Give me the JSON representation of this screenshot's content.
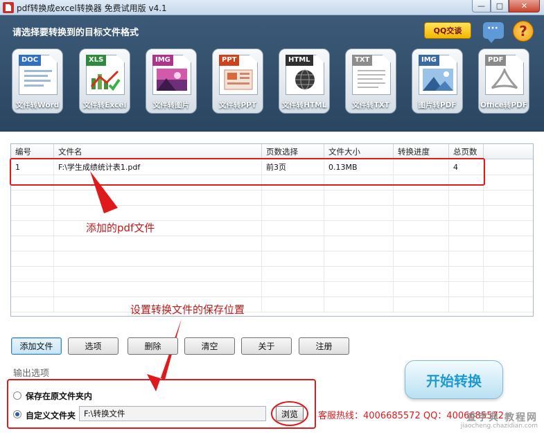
{
  "window": {
    "title": "pdf转换成excel转换器 免费试用版 v4.1",
    "minimize": "—",
    "maximize": "□",
    "close": "✕"
  },
  "toolbar": {
    "prompt": "请选择要转换到的目标文件格式",
    "qq_badge": "QQ交谈",
    "help": "?",
    "formats": [
      {
        "tag": "DOC",
        "label": "文件转Word",
        "color": "#2f6fc4"
      },
      {
        "tag": "XLS",
        "label": "文件转Excel",
        "color": "#2e8b3e"
      },
      {
        "tag": "IMG",
        "label": "文件转图片",
        "color": "#b0338a"
      },
      {
        "tag": "PPT",
        "label": "文件转PPT",
        "color": "#d0421b"
      },
      {
        "tag": "HTML",
        "label": "文件转HTML",
        "color": "#303030"
      },
      {
        "tag": "TXT",
        "label": "文件转TXT",
        "color": "#8d8d8d"
      },
      {
        "tag": "IMG",
        "label": "图片转PDF",
        "color": "#3a6aa6"
      },
      {
        "tag": "PDF",
        "label": "Office转PDF",
        "color": "#8a8a8a"
      }
    ]
  },
  "table": {
    "columns": [
      "编号",
      "文件名",
      "页数选择",
      "文件大小",
      "转换进度",
      "总页数"
    ],
    "rows": [
      [
        "1",
        "F:\\学生成绩统计表1.pdf",
        "前3页",
        "0.13MB",
        "",
        "4"
      ]
    ]
  },
  "annotations": {
    "added_file": "添加的pdf文件",
    "save_location": "设置转换文件的保存位置"
  },
  "buttons": {
    "add_file": "添加文件",
    "options": "选项",
    "delete": "删除",
    "clear": "清空",
    "about": "关于",
    "register": "注册",
    "start": "开始转换",
    "browse": "浏览"
  },
  "output": {
    "section_label": "输出选项",
    "opt_original": "保存在原文件夹内",
    "opt_custom": "自定义文件夹",
    "custom_path": "F:\\转换文件",
    "hotline": "客服热线：4006685572 QQ：4006685572"
  },
  "watermark": {
    "line1": "查字典 教程网",
    "line2": "jiaocheng.chazidian.com"
  },
  "colors": {
    "toolbar_bg": "#2f4c69",
    "annotation_red": "#e0191a",
    "start_text": "#1f9ad0"
  }
}
